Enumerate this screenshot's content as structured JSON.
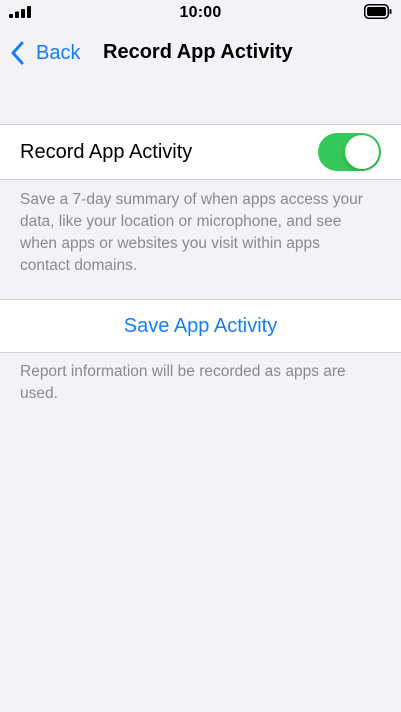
{
  "status_bar": {
    "time": "10:00",
    "signal_icon": "cellular-signal-icon",
    "battery_icon": "battery-full-icon"
  },
  "nav": {
    "back_label": "Back",
    "back_icon": "chevron-left-icon",
    "title": "Record App Activity"
  },
  "settings": {
    "record_toggle": {
      "label": "Record App Activity",
      "on": true
    },
    "record_footer": "Save a 7-day summary of when apps access your data, like your location or microphone, and see when apps or websites you visit within apps contact domains.",
    "save_action_label": "Save App Activity",
    "save_footer": "Report information will be recorded as apps are used."
  },
  "colors": {
    "accent": "#157ef6",
    "toggle_on": "#34c759",
    "background": "#f2f2f7",
    "secondary_text": "#8a8a8e"
  }
}
